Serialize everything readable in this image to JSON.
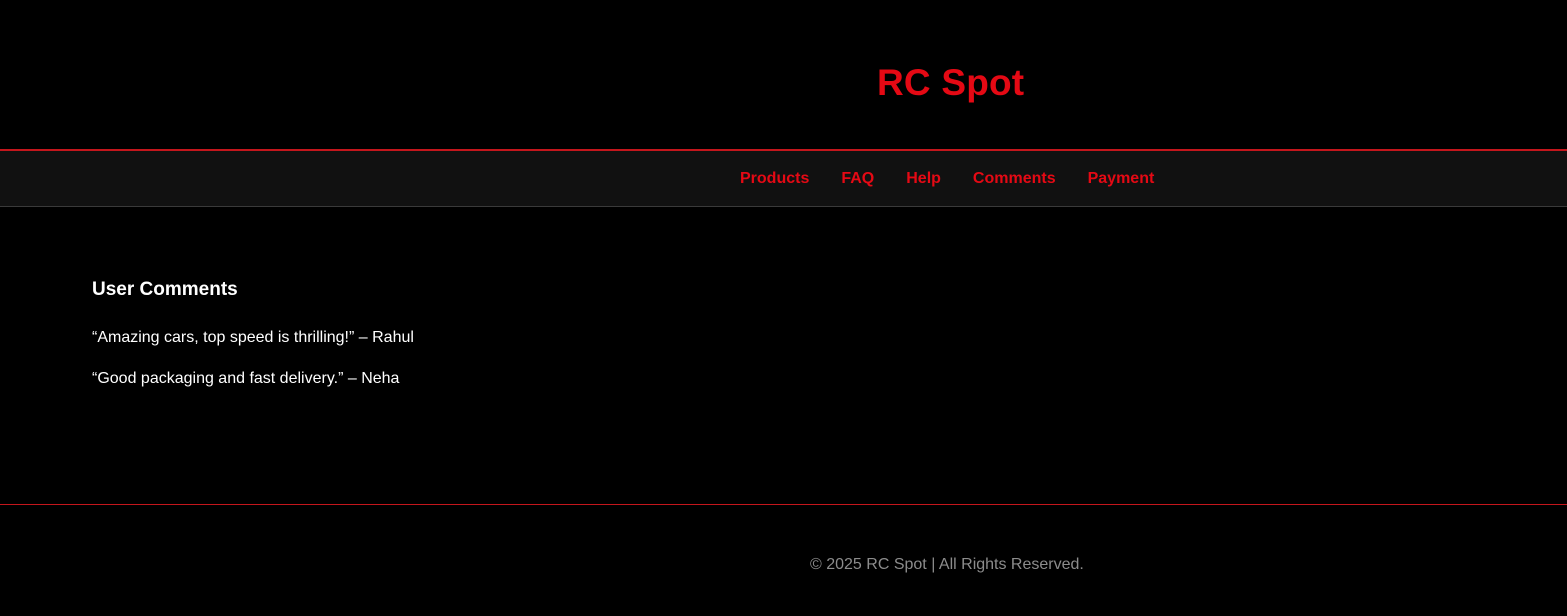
{
  "header": {
    "site_title": "RC Spot"
  },
  "nav": {
    "items": [
      {
        "label": "Products"
      },
      {
        "label": "FAQ"
      },
      {
        "label": "Help"
      },
      {
        "label": "Comments"
      },
      {
        "label": "Payment"
      }
    ]
  },
  "comments_section": {
    "heading": "User Comments",
    "comments": [
      {
        "text": "“Amazing cars, top speed is thrilling!” – Rahul"
      },
      {
        "text": "“Good packaging and fast delivery.” – Neha"
      }
    ]
  },
  "footer": {
    "text": "© 2025 RC Spot | All Rights Reserved."
  },
  "colors": {
    "accent": "#e50914",
    "background": "#000000",
    "nav_background": "#111111",
    "footer_text": "#8c8c8c"
  }
}
